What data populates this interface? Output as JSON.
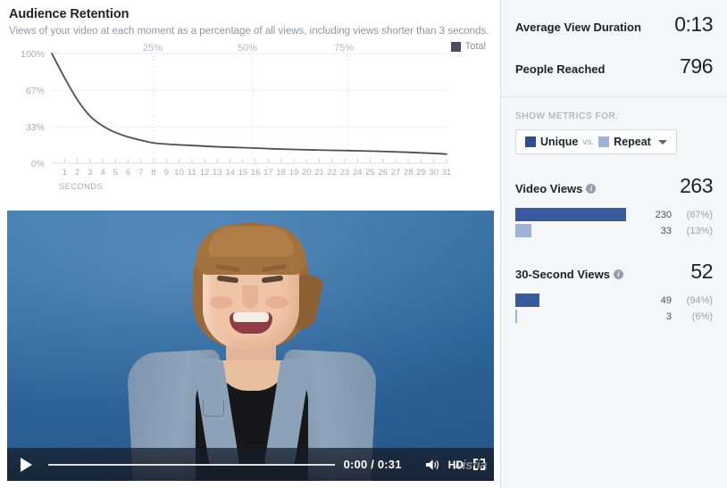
{
  "header": {
    "title": "Audience Retention",
    "subtitle": "Views of your video at each moment as a percentage of all views, including views shorter than 3 seconds."
  },
  "legend": {
    "label": "Total",
    "color": "#4b4f5c"
  },
  "chart_data": {
    "type": "line",
    "title": "Audience Retention",
    "xlabel": "SECONDS",
    "ylabel": "",
    "ylim": [
      0,
      100
    ],
    "ytick_labels": [
      "100%",
      "67%",
      "33%",
      "0%"
    ],
    "ytick_values": [
      100,
      67,
      33,
      0
    ],
    "xtick_labels": [
      "1",
      "2",
      "3",
      "4",
      "5",
      "6",
      "7",
      "8",
      "9",
      "10",
      "11",
      "12",
      "13",
      "14",
      "15",
      "16",
      "17",
      "18",
      "19",
      "20",
      "21",
      "22",
      "23",
      "24",
      "25",
      "26",
      "27",
      "28",
      "29",
      "30",
      "31"
    ],
    "x": [
      0,
      1,
      2,
      3,
      4,
      5,
      6,
      7,
      8,
      9,
      10,
      11,
      12,
      13,
      14,
      15,
      16,
      17,
      18,
      19,
      20,
      21,
      22,
      23,
      24,
      25,
      26,
      27,
      28,
      29,
      30,
      31
    ],
    "top_percent_marks": [
      {
        "label": "25%",
        "at_second": 8
      },
      {
        "label": "50%",
        "at_second": 15.5
      },
      {
        "label": "75%",
        "at_second": 23
      },
      {
        "label": "Total",
        "at_second": null
      }
    ],
    "grid": true,
    "legend_position": "top-right",
    "series": [
      {
        "name": "Total",
        "color": "#4b4f5c",
        "values": [
          100,
          78,
          58,
          43,
          34,
          28,
          24,
          21,
          18.5,
          17.5,
          16.8,
          16.2,
          15.6,
          15.0,
          14.6,
          14.2,
          13.8,
          13.3,
          12.9,
          12.6,
          12.3,
          12.0,
          11.8,
          11.6,
          11.4,
          11.1,
          10.8,
          10.4,
          10.0,
          9.5,
          9.0,
          8.4
        ]
      }
    ]
  },
  "video": {
    "current_time": "0:00",
    "duration": "0:31",
    "time_display": "0:00 / 0:31",
    "quality_label": "HD",
    "watermark": "wistia",
    "progress_percent": 0,
    "icons": {
      "play": "play-icon",
      "volume": "volume-icon",
      "fullscreen": "fullscreen-icon"
    }
  },
  "sidebar": {
    "kpis": [
      {
        "label": "Average View Duration",
        "value": "0:13"
      },
      {
        "label": "People Reached",
        "value": "796"
      }
    ],
    "show_metrics_for": {
      "caption": "SHOW METRICS FOR:",
      "unique_label": "Unique",
      "vs_label": "vs.",
      "repeat_label": "Repeat",
      "unique_color": "#2f4d8f",
      "repeat_color": "#9fb3d9"
    },
    "sections": [
      {
        "title": "Video Views",
        "total": "263",
        "bars": [
          {
            "type": "unique",
            "count": "230",
            "percent": "(87%)",
            "width_pct": 87.0,
            "color": "#3b5a9b"
          },
          {
            "type": "repeat",
            "count": "33",
            "percent": "(13%)",
            "width_pct": 12.5,
            "color": "#9fb3d9"
          }
        ]
      },
      {
        "title": "30-Second Views",
        "total": "52",
        "bars": [
          {
            "type": "unique",
            "count": "49",
            "percent": "(94%)",
            "width_pct": 18.6,
            "color": "#3b5a9b"
          },
          {
            "type": "repeat",
            "count": "3",
            "percent": "(6%)",
            "width_pct": 1.2,
            "color": "#9fb3d9"
          }
        ]
      }
    ]
  }
}
